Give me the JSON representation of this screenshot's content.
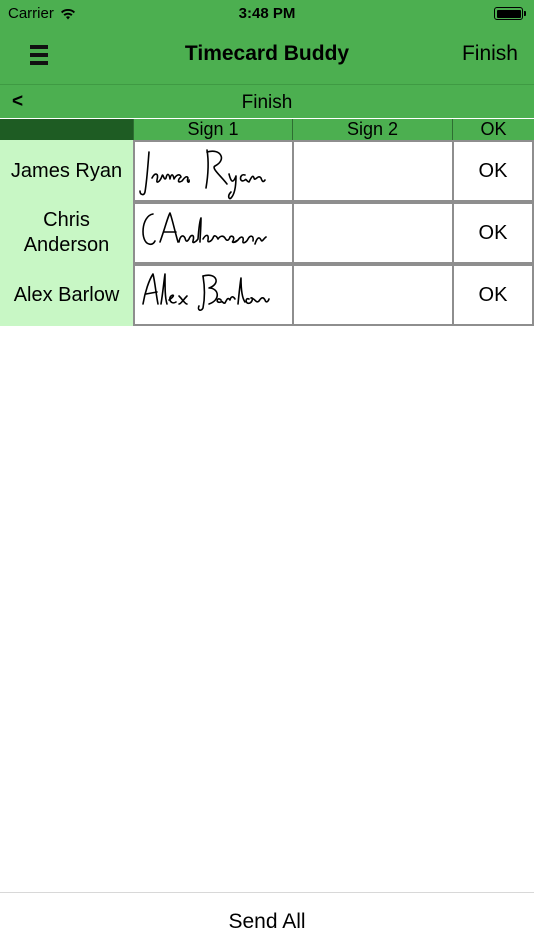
{
  "status_bar": {
    "carrier": "Carrier",
    "time": "3:48 PM",
    "wifi_icon": "wifi-icon",
    "battery_icon": "battery-icon"
  },
  "nav": {
    "menu_icon": "hamburger-icon",
    "title": "Timecard Buddy",
    "finish_label": "Finish"
  },
  "sub_nav": {
    "back_label": "<",
    "title": "Finish"
  },
  "table": {
    "columns": [
      "",
      "Sign 1",
      "Sign 2",
      "OK"
    ],
    "rows": [
      {
        "name": "James Ryan",
        "sign1": "James Ryan",
        "sign2": "",
        "ok": "OK"
      },
      {
        "name": "Chris Anderson",
        "sign1": "C Anderson",
        "sign2": "",
        "ok": "OK"
      },
      {
        "name": "Alex Barlow",
        "sign1": "Alex Barlow",
        "sign2": "",
        "ok": "OK"
      }
    ]
  },
  "footer": {
    "send_all_label": "Send All"
  },
  "colors": {
    "bar_green": "#4caf50",
    "corner_dark_green": "#1e5c23",
    "name_cell_green": "#c8f7c5",
    "cell_border": "#8e8e8e"
  }
}
